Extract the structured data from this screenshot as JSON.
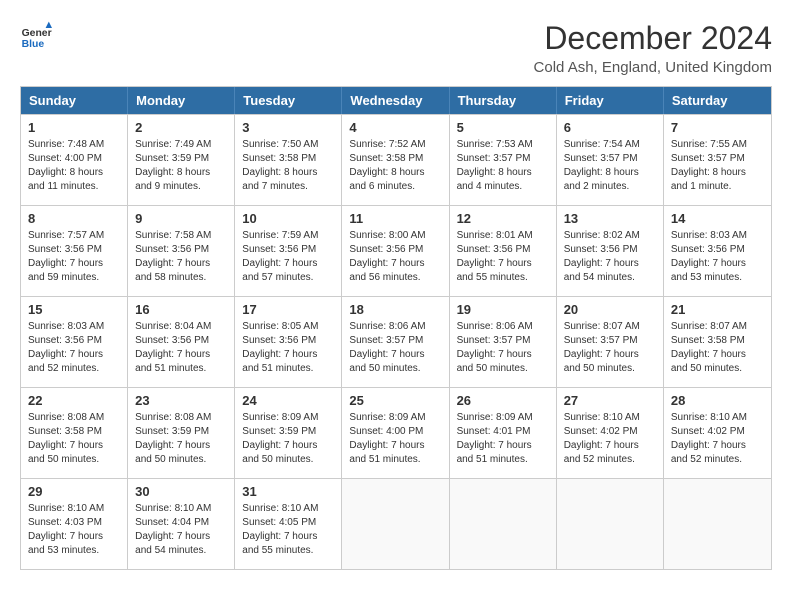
{
  "logo": {
    "text_general": "General",
    "text_blue": "Blue"
  },
  "header": {
    "title": "December 2024",
    "subtitle": "Cold Ash, England, United Kingdom"
  },
  "calendar": {
    "days_of_week": [
      "Sunday",
      "Monday",
      "Tuesday",
      "Wednesday",
      "Thursday",
      "Friday",
      "Saturday"
    ],
    "weeks": [
      [
        {
          "day": 1,
          "sunrise": "Sunrise: 7:48 AM",
          "sunset": "Sunset: 4:00 PM",
          "daylight": "Daylight: 8 hours and 11 minutes."
        },
        {
          "day": 2,
          "sunrise": "Sunrise: 7:49 AM",
          "sunset": "Sunset: 3:59 PM",
          "daylight": "Daylight: 8 hours and 9 minutes."
        },
        {
          "day": 3,
          "sunrise": "Sunrise: 7:50 AM",
          "sunset": "Sunset: 3:58 PM",
          "daylight": "Daylight: 8 hours and 7 minutes."
        },
        {
          "day": 4,
          "sunrise": "Sunrise: 7:52 AM",
          "sunset": "Sunset: 3:58 PM",
          "daylight": "Daylight: 8 hours and 6 minutes."
        },
        {
          "day": 5,
          "sunrise": "Sunrise: 7:53 AM",
          "sunset": "Sunset: 3:57 PM",
          "daylight": "Daylight: 8 hours and 4 minutes."
        },
        {
          "day": 6,
          "sunrise": "Sunrise: 7:54 AM",
          "sunset": "Sunset: 3:57 PM",
          "daylight": "Daylight: 8 hours and 2 minutes."
        },
        {
          "day": 7,
          "sunrise": "Sunrise: 7:55 AM",
          "sunset": "Sunset: 3:57 PM",
          "daylight": "Daylight: 8 hours and 1 minute."
        }
      ],
      [
        {
          "day": 8,
          "sunrise": "Sunrise: 7:57 AM",
          "sunset": "Sunset: 3:56 PM",
          "daylight": "Daylight: 7 hours and 59 minutes."
        },
        {
          "day": 9,
          "sunrise": "Sunrise: 7:58 AM",
          "sunset": "Sunset: 3:56 PM",
          "daylight": "Daylight: 7 hours and 58 minutes."
        },
        {
          "day": 10,
          "sunrise": "Sunrise: 7:59 AM",
          "sunset": "Sunset: 3:56 PM",
          "daylight": "Daylight: 7 hours and 57 minutes."
        },
        {
          "day": 11,
          "sunrise": "Sunrise: 8:00 AM",
          "sunset": "Sunset: 3:56 PM",
          "daylight": "Daylight: 7 hours and 56 minutes."
        },
        {
          "day": 12,
          "sunrise": "Sunrise: 8:01 AM",
          "sunset": "Sunset: 3:56 PM",
          "daylight": "Daylight: 7 hours and 55 minutes."
        },
        {
          "day": 13,
          "sunrise": "Sunrise: 8:02 AM",
          "sunset": "Sunset: 3:56 PM",
          "daylight": "Daylight: 7 hours and 54 minutes."
        },
        {
          "day": 14,
          "sunrise": "Sunrise: 8:03 AM",
          "sunset": "Sunset: 3:56 PM",
          "daylight": "Daylight: 7 hours and 53 minutes."
        }
      ],
      [
        {
          "day": 15,
          "sunrise": "Sunrise: 8:03 AM",
          "sunset": "Sunset: 3:56 PM",
          "daylight": "Daylight: 7 hours and 52 minutes."
        },
        {
          "day": 16,
          "sunrise": "Sunrise: 8:04 AM",
          "sunset": "Sunset: 3:56 PM",
          "daylight": "Daylight: 7 hours and 51 minutes."
        },
        {
          "day": 17,
          "sunrise": "Sunrise: 8:05 AM",
          "sunset": "Sunset: 3:56 PM",
          "daylight": "Daylight: 7 hours and 51 minutes."
        },
        {
          "day": 18,
          "sunrise": "Sunrise: 8:06 AM",
          "sunset": "Sunset: 3:57 PM",
          "daylight": "Daylight: 7 hours and 50 minutes."
        },
        {
          "day": 19,
          "sunrise": "Sunrise: 8:06 AM",
          "sunset": "Sunset: 3:57 PM",
          "daylight": "Daylight: 7 hours and 50 minutes."
        },
        {
          "day": 20,
          "sunrise": "Sunrise: 8:07 AM",
          "sunset": "Sunset: 3:57 PM",
          "daylight": "Daylight: 7 hours and 50 minutes."
        },
        {
          "day": 21,
          "sunrise": "Sunrise: 8:07 AM",
          "sunset": "Sunset: 3:58 PM",
          "daylight": "Daylight: 7 hours and 50 minutes."
        }
      ],
      [
        {
          "day": 22,
          "sunrise": "Sunrise: 8:08 AM",
          "sunset": "Sunset: 3:58 PM",
          "daylight": "Daylight: 7 hours and 50 minutes."
        },
        {
          "day": 23,
          "sunrise": "Sunrise: 8:08 AM",
          "sunset": "Sunset: 3:59 PM",
          "daylight": "Daylight: 7 hours and 50 minutes."
        },
        {
          "day": 24,
          "sunrise": "Sunrise: 8:09 AM",
          "sunset": "Sunset: 3:59 PM",
          "daylight": "Daylight: 7 hours and 50 minutes."
        },
        {
          "day": 25,
          "sunrise": "Sunrise: 8:09 AM",
          "sunset": "Sunset: 4:00 PM",
          "daylight": "Daylight: 7 hours and 51 minutes."
        },
        {
          "day": 26,
          "sunrise": "Sunrise: 8:09 AM",
          "sunset": "Sunset: 4:01 PM",
          "daylight": "Daylight: 7 hours and 51 minutes."
        },
        {
          "day": 27,
          "sunrise": "Sunrise: 8:10 AM",
          "sunset": "Sunset: 4:02 PM",
          "daylight": "Daylight: 7 hours and 52 minutes."
        },
        {
          "day": 28,
          "sunrise": "Sunrise: 8:10 AM",
          "sunset": "Sunset: 4:02 PM",
          "daylight": "Daylight: 7 hours and 52 minutes."
        }
      ],
      [
        {
          "day": 29,
          "sunrise": "Sunrise: 8:10 AM",
          "sunset": "Sunset: 4:03 PM",
          "daylight": "Daylight: 7 hours and 53 minutes."
        },
        {
          "day": 30,
          "sunrise": "Sunrise: 8:10 AM",
          "sunset": "Sunset: 4:04 PM",
          "daylight": "Daylight: 7 hours and 54 minutes."
        },
        {
          "day": 31,
          "sunrise": "Sunrise: 8:10 AM",
          "sunset": "Sunset: 4:05 PM",
          "daylight": "Daylight: 7 hours and 55 minutes."
        },
        null,
        null,
        null,
        null
      ]
    ]
  }
}
